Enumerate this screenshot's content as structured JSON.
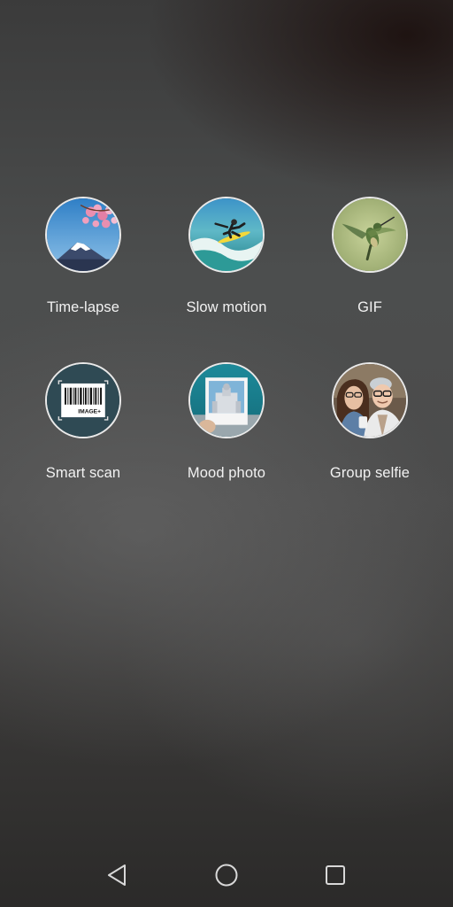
{
  "modes": [
    {
      "label": "Time-lapse",
      "icon": "mount-fuji-icon"
    },
    {
      "label": "Slow motion",
      "icon": "surfer-icon"
    },
    {
      "label": "GIF",
      "icon": "hummingbird-icon"
    },
    {
      "label": "Smart scan",
      "icon": "barcode-icon",
      "barcode_text": "IMAGE+"
    },
    {
      "label": "Mood photo",
      "icon": "polaroid-photo-icon"
    },
    {
      "label": "Group selfie",
      "icon": "couple-selfie-icon"
    }
  ],
  "navbar": {
    "back_icon": "back-triangle-icon",
    "home_icon": "home-circle-icon",
    "recents_icon": "recents-square-icon"
  },
  "colors": {
    "label_text": "#f2f2f2",
    "thumb_border": "#e9e9e9",
    "nav_icon": "#d8d8d8"
  }
}
